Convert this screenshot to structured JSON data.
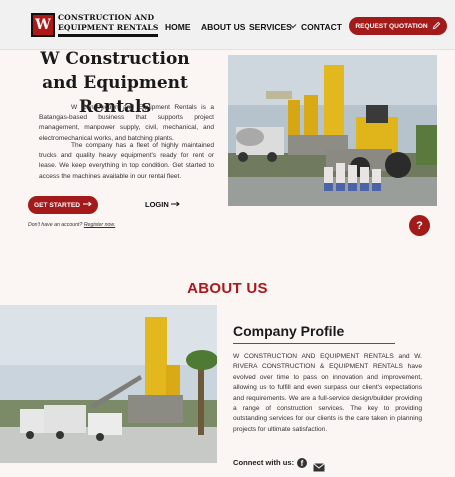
{
  "brand": {
    "mark": "W",
    "line1": "CONSTRUCTION AND",
    "line2": "EQUIPMENT RENTALS"
  },
  "nav": {
    "home": "HOME",
    "about": "ABOUT US",
    "services": "SERVICES",
    "contact": "CONTACT",
    "quote_button": "REQUEST QUOTATION"
  },
  "hero": {
    "title": "W Construction and Equipment Rentals",
    "paragraph1": "W Construction and Equipment Rentals is a Batangas-based business that supports project management, manpower supply, civil, mechanical, and electromechanical works, and batching plants.",
    "paragraph2": "The company has a fleet of highly maintained trucks and quality heavy equipment's ready for rent or lease. We keep everything in top condition. Get started to access the machines available in our rental fleet.",
    "get_started": "GET STARTED",
    "login": "LOGIN",
    "no_account": "Don't have an account?",
    "register": "Register now."
  },
  "help": {
    "label": "?"
  },
  "about": {
    "heading": "ABOUT US",
    "profile_title": "Company Profile",
    "profile_text": "W CONSTRUCTION AND EQUIPMENT RENTALS and W. RIVERA CONSTRUCTION & EQUIPMENT RENTALS have evolved over time to pass on innovation and improvement, allowing us to fulfill and even surpass our client's expectations and requirements. We are a full-service design/builder providing a range of construction services. The key to providing outstanding services for our clients is the care taken in planning projects for ultimate satisfaction.",
    "connect": "Connect with us:"
  },
  "icons": [
    "pencil-icon",
    "arrow-right-icon",
    "chevron-down-icon",
    "facebook-icon",
    "mail-icon"
  ],
  "colors": {
    "accent": "#a21a1a",
    "heading_red": "#b01818",
    "background": "#fbf5f4"
  }
}
